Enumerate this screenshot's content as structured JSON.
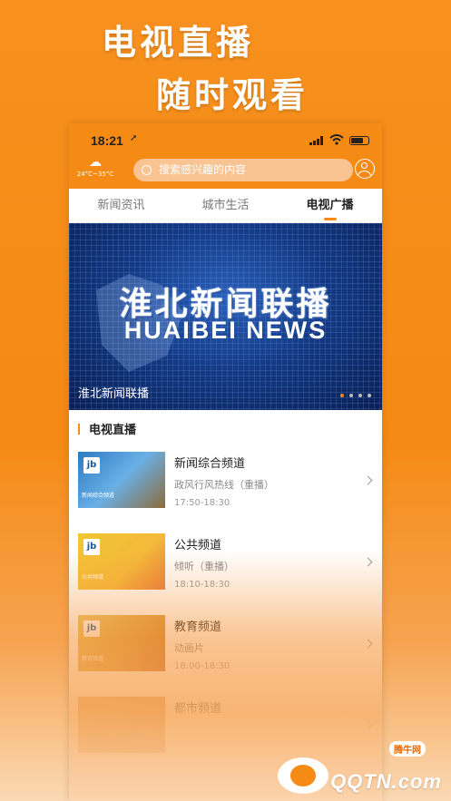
{
  "promo": {
    "line1": "电视直播",
    "line2": "随时观看"
  },
  "status_bar": {
    "time": "18:21",
    "location_arrow": "➚"
  },
  "header": {
    "weather_icon": "cloud-icon",
    "temperature": "24°C~35°C",
    "search_placeholder": "搜索感兴趣的内容"
  },
  "tabs": [
    {
      "label": "新闻资讯",
      "active": false
    },
    {
      "label": "城市生活",
      "active": false
    },
    {
      "label": "电视广播",
      "active": true
    }
  ],
  "banner": {
    "title_cn": "淮北新闻联播",
    "title_en": "HUAIBEI NEWS",
    "caption": "淮北新闻联播",
    "slides": 4,
    "active_slide": 2
  },
  "section": {
    "title": "电视直播"
  },
  "channels": [
    {
      "name": "新闻综合频道",
      "program": "政风行风热线（重播）",
      "time": "17:50-18:30",
      "thumb_text": "新闻综合频道"
    },
    {
      "name": "公共频道",
      "program": "倾听（重播）",
      "time": "18:10-18:30",
      "thumb_text": "公共频道"
    },
    {
      "name": "教育频道",
      "program": "动画片",
      "time": "18:00-18:30",
      "thumb_text": "教育频道"
    },
    {
      "name": "都市频道",
      "program": "",
      "time": "",
      "thumb_text": ""
    }
  ],
  "watermark": {
    "text": "QQTN.com",
    "tag": "腾牛网"
  },
  "colors": {
    "accent": "#f58a14"
  }
}
